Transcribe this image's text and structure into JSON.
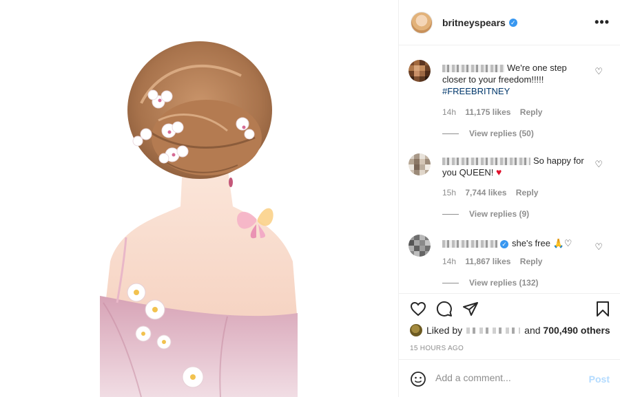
{
  "post": {
    "username": "britneyspears",
    "verified": true,
    "more_icon": "more-horizontal-icon"
  },
  "comments": [
    {
      "text": "We're one step closer to your freedom!!!!!",
      "hashtag": "#FREEBRITNEY",
      "time": "14h",
      "likes": "11,175 likes",
      "reply": "Reply",
      "view_replies": "View replies (50)"
    },
    {
      "text": "So happy for you QUEEN!",
      "emoji": "♥",
      "time": "15h",
      "likes": "7,744 likes",
      "reply": "Reply",
      "view_replies": "View replies (9)"
    },
    {
      "text": "she's free 🙏♡",
      "time": "14h",
      "likes": "11,867 likes",
      "reply": "Reply",
      "view_replies": "View replies (132)"
    }
  ],
  "likes": {
    "prefix": "Liked by",
    "and": "and",
    "count": "700,490 others"
  },
  "timestamp": "15 HOURS AGO",
  "add_comment": {
    "placeholder": "Add a comment...",
    "post_label": "Post"
  },
  "colors": {
    "link": "#00376b",
    "muted": "#8e8e8e",
    "verified": "#3897f0",
    "post_disabled": "#b3dbff"
  }
}
